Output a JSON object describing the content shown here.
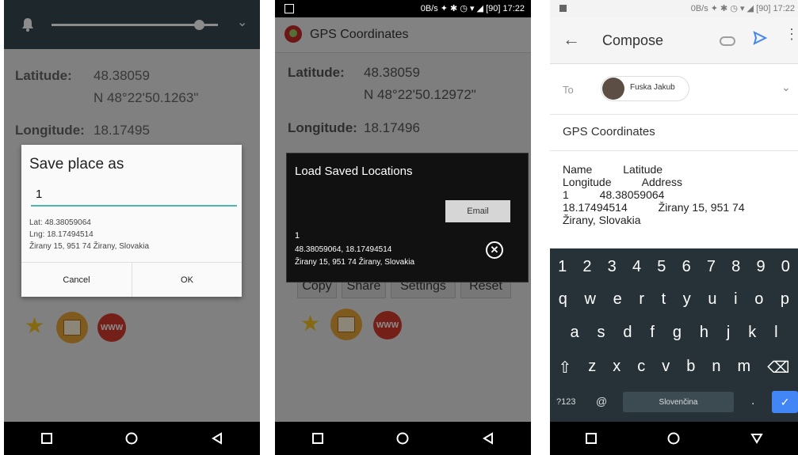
{
  "panel1": {
    "latitude_label": "Latitude:",
    "latitude_decimal": "48.38059",
    "latitude_dms": "N 48°22'50.1263\"",
    "longitude_label": "Longitude:",
    "longitude_decimal": "18.17495",
    "dialog": {
      "title": "Save place as",
      "name_value": "1",
      "lat": "Lat: 48.38059064",
      "lng": "Lng: 18.17494514",
      "address": "Žirany 15, 951 74 Žirany, Slovakia",
      "cancel": "Cancel",
      "ok": "OK"
    }
  },
  "panel2": {
    "status_right": "0B/s ✦ ✱ ◷ ▾ ◢ [90] 17:22",
    "app_title": "GPS Coordinates",
    "latitude_label": "Latitude:",
    "latitude_decimal": "48.38059",
    "latitude_dms": "N 48°22'50.12972\"",
    "longitude_label": "Longitude:",
    "longitude_decimal": "18.17496",
    "buttons": [
      "Copy",
      "Share",
      "Settings",
      "Reset"
    ],
    "dialog": {
      "title": "Load Saved Locations",
      "email": "Email",
      "item_name": "1",
      "item_coords": "48.38059064, 18.17494514",
      "item_address": "Žirany 15, 951 74 Žirany, Slovakia"
    }
  },
  "panel3": {
    "status_right": "0B/s ✦ ✱ ◷ ▾ ◢ [90] 17:22",
    "title": "Compose",
    "to_label": "To",
    "recipient": "Fuska Jakub",
    "subject": "GPS Coordinates",
    "body_line1": "Name          Latitude",
    "body_line2": "Longitude          Address",
    "body_line3": "1          48.38059064",
    "body_line4": "18.17494514          Žirany 15, 951 74",
    "body_line5": "Žirany, Slovakia",
    "keyboard": {
      "row1": [
        "1",
        "2",
        "3",
        "4",
        "5",
        "6",
        "7",
        "8",
        "9",
        "0"
      ],
      "row2": [
        "q",
        "w",
        "e",
        "r",
        "t",
        "y",
        "u",
        "i",
        "o",
        "p"
      ],
      "row3": [
        "a",
        "s",
        "d",
        "f",
        "g",
        "h",
        "j",
        "k",
        "l"
      ],
      "row4": [
        "z",
        "x",
        "c",
        "v",
        "b",
        "n",
        "m"
      ],
      "sym": "?123",
      "at": "@",
      "space": "Slovenčina",
      "dot": "."
    }
  },
  "colors": {
    "toolbar_dark": "#37474f",
    "app_bg": "#e6e6e6",
    "keyboard_bg": "#263238",
    "gmail_blue": "#4285f4"
  }
}
